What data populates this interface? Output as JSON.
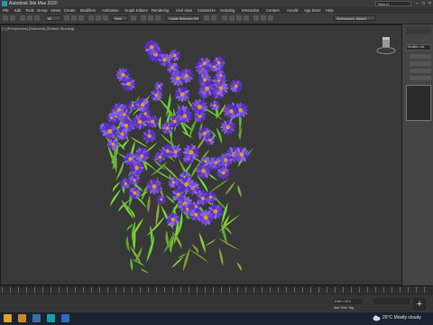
{
  "app": {
    "title": "Autodesk 3ds Max 2020",
    "signin": "Sign In"
  },
  "menus": [
    "File",
    "Edit",
    "Tools",
    "Group",
    "Views",
    "Create",
    "Modifiers",
    "Animation",
    "Graph Editors",
    "Rendering",
    "Civil View",
    "Customize",
    "Scripting",
    "Interactive",
    "Content",
    "Arnold",
    "App Store",
    "Help"
  ],
  "toolbar": {
    "filter": "All",
    "view": "View",
    "selection_set": "Create Selection Set",
    "workspace": "Workspaces: Default"
  },
  "viewport": {
    "label": "[+] [Perspective] [Standard] [Default Shading]"
  },
  "panel": {
    "modifier_list": "Modifier List"
  },
  "status": {
    "coord": "Grid = 10.0",
    "add_tag": "Add Time Tag"
  },
  "taskbar": {
    "weather_temp": "26°C",
    "weather_text": "Mostly cloudy"
  },
  "colors": {
    "flower": "#6a4cc9",
    "leaf": "#7cc43c",
    "viewport_bg": "#383838"
  },
  "icons": [
    "app-icon",
    "gear-icon",
    "search-icon",
    "folder-icon",
    "store-icon",
    "cloud-icon"
  ]
}
